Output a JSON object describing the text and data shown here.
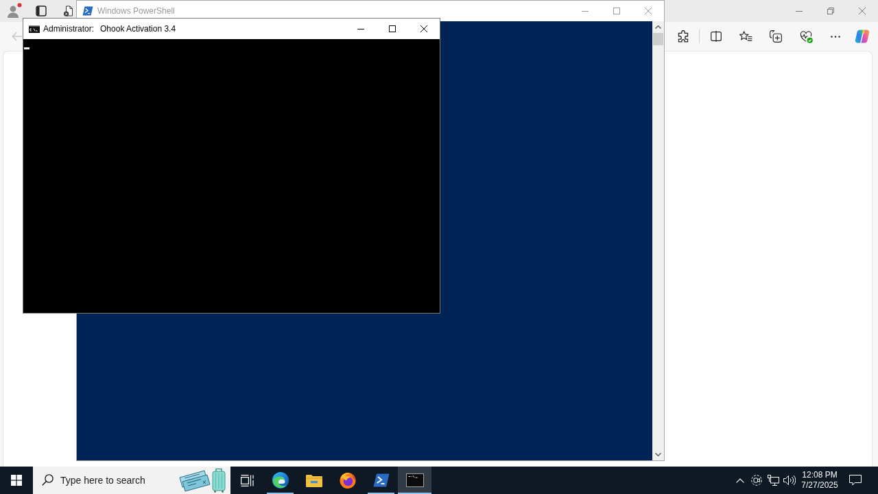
{
  "browser": {
    "back_button": {
      "disabled": true
    }
  },
  "powershell_window": {
    "title": "Windows PowerShell",
    "active": false
  },
  "console_window": {
    "title_prefix": "Administrator:",
    "title": "Ohook Activation 3.4",
    "active": true
  },
  "taskbar": {
    "search": {
      "placeholder": "Type here to search"
    },
    "apps": [
      {
        "kind": "edge",
        "running": true,
        "selected": false
      },
      {
        "kind": "folder",
        "running": false,
        "selected": false
      },
      {
        "kind": "firefox",
        "running": false,
        "selected": false
      },
      {
        "kind": "powershell",
        "running": true,
        "selected": false
      },
      {
        "kind": "console",
        "running": true,
        "selected": true
      }
    ],
    "clock": {
      "time": "12:08 PM",
      "date": "7/27/2025"
    }
  }
}
